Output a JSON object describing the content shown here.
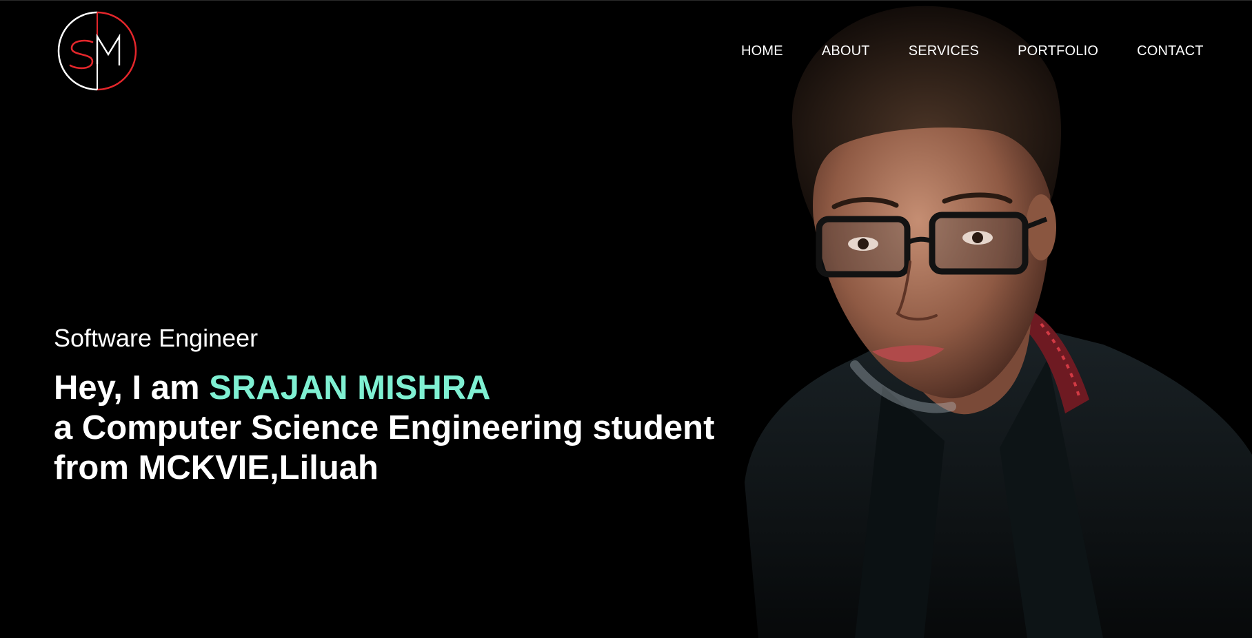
{
  "logo": {
    "letters": [
      "S",
      "M"
    ],
    "colors": {
      "accent": "#e3262b",
      "stroke": "#ffffff"
    }
  },
  "nav": {
    "items": [
      {
        "label": "HOME"
      },
      {
        "label": "ABOUT"
      },
      {
        "label": "SERVICES"
      },
      {
        "label": "PORTFOLIO"
      },
      {
        "label": "CONTACT"
      }
    ]
  },
  "hero": {
    "subtitle": "Software Engineer",
    "greeting": "Hey, I am ",
    "name": "SRAJAN MISHRA",
    "line2": "a Computer Science Engineering student",
    "line3": "from MCKVIE,Liluah"
  },
  "colors": {
    "background": "#000000",
    "text": "#ffffff",
    "name_accent": "#7ff0d2"
  },
  "portrait": {
    "icon": "person-photo"
  }
}
